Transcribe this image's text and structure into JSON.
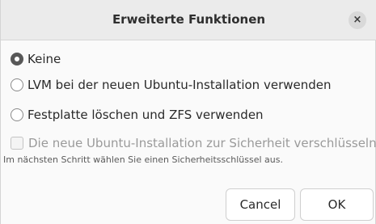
{
  "dialog": {
    "title": "Erweiterte Funktionen",
    "close_glyph": "×",
    "options": [
      {
        "label": "Keine",
        "selected": true
      },
      {
        "label": "LVM bei der neuen Ubuntu-Installation verwenden",
        "selected": false
      },
      {
        "label": "Festplatte löschen und ZFS verwenden",
        "selected": false
      }
    ],
    "encrypt": {
      "label": "Die neue Ubuntu-Installation zur Sicherheit verschlüsseln",
      "checked": false,
      "enabled": false
    },
    "hint": "Im nächsten Schritt wählen Sie einen Sicherheitsschlüssel aus.",
    "buttons": {
      "cancel": "Cancel",
      "ok": "OK"
    }
  }
}
